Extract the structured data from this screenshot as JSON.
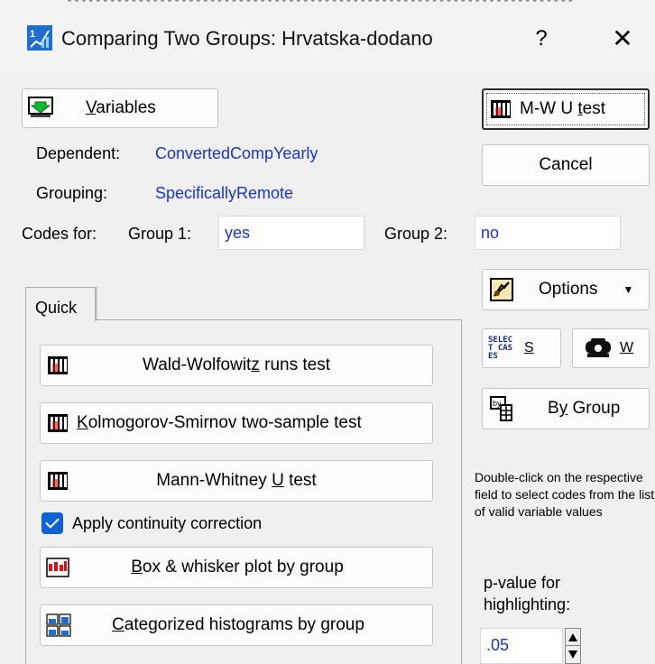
{
  "window": {
    "title": "Comparing Two Groups: Hrvatska-dodano",
    "help_label": "?",
    "close_label": "✕"
  },
  "variables_button": {
    "label_rest": "ariables",
    "label_u": "V"
  },
  "dependent": {
    "label": "Dependent:",
    "value": "ConvertedCompYearly"
  },
  "grouping": {
    "label": "Grouping:",
    "value": "SpecificallyRemote"
  },
  "codes": {
    "label": "Codes for:",
    "group1_label": "Group 1:",
    "group1_value": "yes",
    "group2_label": "Group 2:",
    "group2_value": "no"
  },
  "right_buttons": {
    "mwu": {
      "pre": "M-W U ",
      "u": "t",
      "post": "est"
    },
    "cancel": "Cancel",
    "options": "Options",
    "select_cases_icon_text": "SELECT CASES",
    "select_cases_label": "S",
    "weight_label": "W",
    "by_group": {
      "pre": "B",
      "u": "y",
      "post": " Group"
    }
  },
  "tabs": [
    {
      "label": "Quick"
    }
  ],
  "quick": {
    "wald": {
      "pre": "Wald-Wolfowit",
      "u": "z",
      "post": " runs test"
    },
    "ks": {
      "u": "K",
      "post": "olmogorov-Smirnov two-sample test"
    },
    "mw": {
      "pre": "Mann-Whitney ",
      "u": "U",
      "post": " test"
    },
    "continuity": {
      "label": "Apply continuity correction",
      "checked": true
    },
    "box": {
      "u": "B",
      "post": "ox & whisker plot by group"
    },
    "hist": {
      "u": "C",
      "post": "ategorized histograms by group"
    }
  },
  "hint": "Double-click on the respective field to select codes from the list of valid variable values",
  "pvalue": {
    "label_line1": "p-value for",
    "label_line2": "highlighting:",
    "value": ".05"
  },
  "icons": [
    "app-icon",
    "variables-icon",
    "grid-icon",
    "options-icon",
    "select-cases-icon",
    "weight-icon",
    "by-group-icon",
    "box-plot-icon",
    "histogram-icon"
  ]
}
